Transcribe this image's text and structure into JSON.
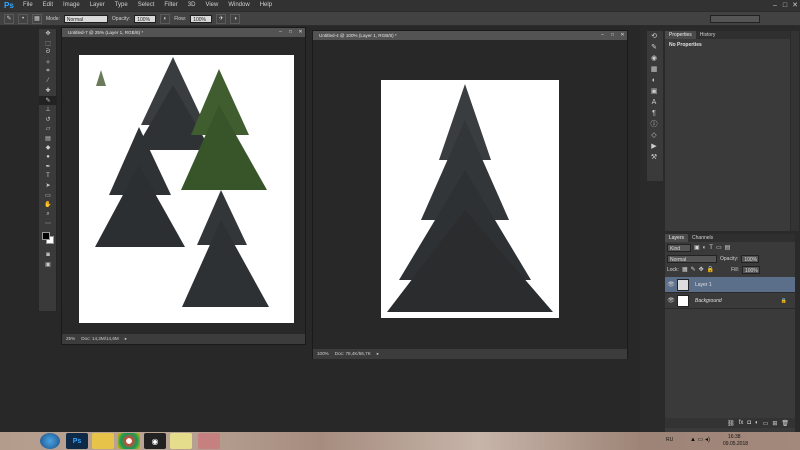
{
  "app": {
    "logo": "Ps"
  },
  "menubar": {
    "items": [
      "File",
      "Edit",
      "Image",
      "Layer",
      "Type",
      "Select",
      "Filter",
      "3D",
      "View",
      "Window",
      "Help"
    ]
  },
  "options": {
    "mode_label": "Mode:",
    "mode_value": "Normal",
    "opacity_label": "Opacity:",
    "opacity_value": "100%",
    "flow_label": "Flow:",
    "flow_value": "100%"
  },
  "doc1": {
    "title": "Untitled-7 @ 25% (Layer 1, RGB/8) *",
    "zoom": "25%",
    "status": "Doc: 14,3M/14,6M"
  },
  "doc2": {
    "title": "Untitled-4 @ 100% (Layer 1, RGB/8) *",
    "zoom": "100%",
    "status": "Doc: 78,4K/56,7K"
  },
  "properties": {
    "tabs": [
      "Properties",
      "History"
    ],
    "content": "No Properties"
  },
  "layers": {
    "tabs": [
      "Layers",
      "Channels"
    ],
    "kind": "Kind",
    "blend": "Normal",
    "opacity_label": "Opacity:",
    "opacity_value": "100%",
    "lock_label": "Lock:",
    "fill_label": "Fill:",
    "fill_value": "100%",
    "items": [
      {
        "name": "Layer 1",
        "selected": true
      },
      {
        "name": "Background",
        "selected": false
      }
    ]
  },
  "taskbar": {
    "lang": "RU",
    "time": "16:38",
    "date": "09.05.2018"
  },
  "colors": {
    "accent": "#31a8ff",
    "selected_layer": "#5c6f8a",
    "panel_bg": "#2a2a2a",
    "tree_green": "#3f5d2f"
  }
}
